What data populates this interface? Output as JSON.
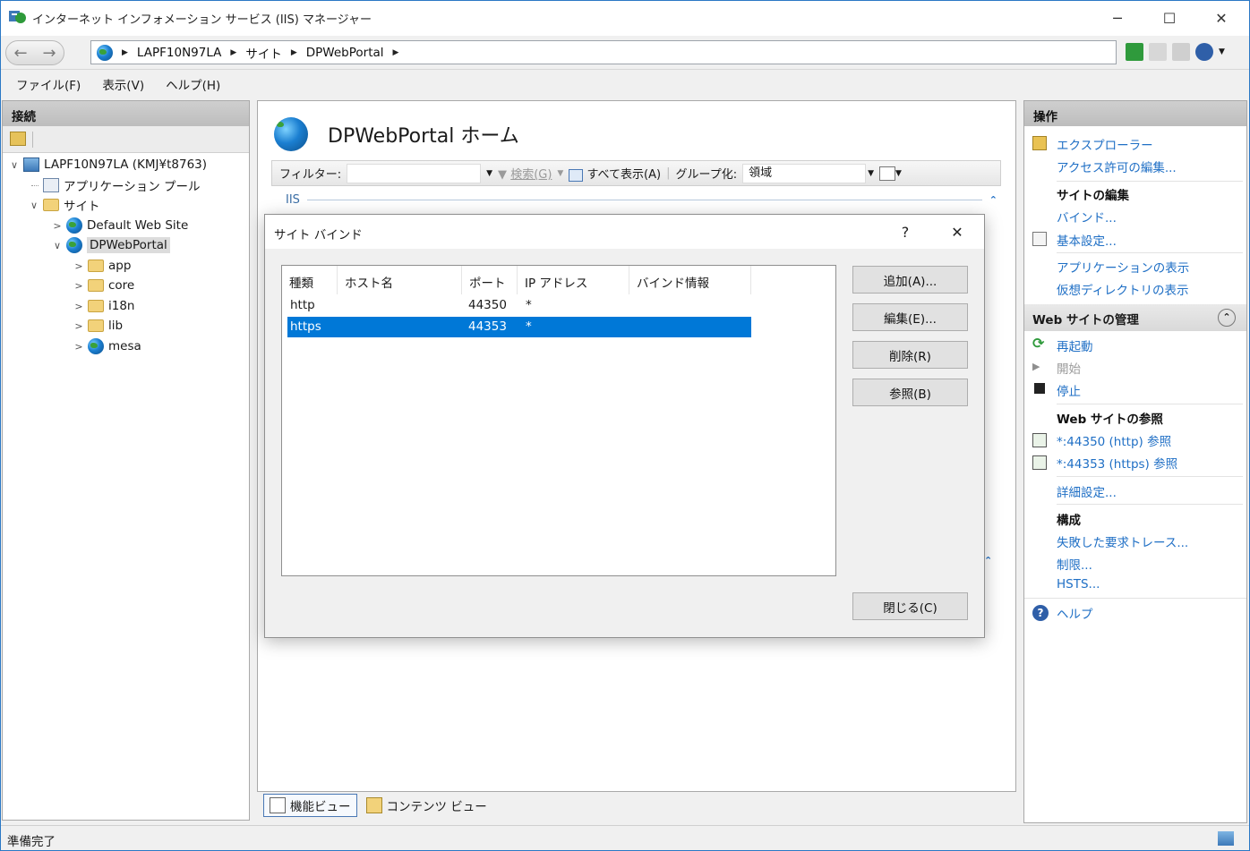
{
  "window": {
    "title": "インターネット インフォメーション サービス (IIS) マネージャー",
    "minimize": "─",
    "maximize": "☐",
    "close": "✕"
  },
  "address": {
    "crumbs": [
      "LAPF10N97LA",
      "サイト",
      "DPWebPortal"
    ],
    "separator": "▶",
    "back": "←",
    "forward": "→"
  },
  "menu": [
    "ファイル(F)",
    "表示(V)",
    "ヘルプ(H)"
  ],
  "connections": {
    "header": "接続",
    "tree": [
      {
        "label": "LAPF10N97LA (KMJ¥t8763)",
        "twisty": "∨"
      },
      {
        "label": "アプリケーション プール",
        "twisty": ""
      },
      {
        "label": "サイト",
        "twisty": "∨"
      },
      {
        "label": "Default Web Site",
        "twisty": ">"
      },
      {
        "label": "DPWebPortal",
        "twisty": "∨"
      },
      {
        "label": "app",
        "twisty": ">"
      },
      {
        "label": "core",
        "twisty": ">"
      },
      {
        "label": "i18n",
        "twisty": ">"
      },
      {
        "label": "lib",
        "twisty": ">"
      },
      {
        "label": "mesa",
        "twisty": ">"
      }
    ]
  },
  "center": {
    "title": "DPWebPortal ホーム",
    "filter_label": "フィルター:",
    "search_label": "検索(G)",
    "show_all_label": "すべて表示(A)",
    "group_label": "グループ化:",
    "group_value": "領域",
    "section_label": "IIS",
    "view_feature": "機能ビュー",
    "view_content": "コンテンツ ビュー"
  },
  "actions": {
    "header": "操作",
    "explore": "エクスプローラー",
    "edit_permissions": "アクセス許可の編集...",
    "edit_site_heading": "サイトの編集",
    "bindings": "バインド...",
    "basic_settings": "基本設定...",
    "view_applications": "アプリケーションの表示",
    "view_vdirs": "仮想ディレクトリの表示",
    "manage_heading": "Web サイトの管理",
    "restart": "再起動",
    "start": "開始",
    "stop": "停止",
    "browse_heading": "Web サイトの参照",
    "browse_http": "*:44350 (http) 参照",
    "browse_https": "*:44353 (https) 参照",
    "advanced": "詳細設定...",
    "config_heading": "構成",
    "failed_trace": "失敗した要求トレース...",
    "limits": "制限...",
    "hsts": "HSTS...",
    "help": "ヘルプ",
    "collapse": "⌃"
  },
  "status": "準備完了",
  "dialog": {
    "title": "サイト バインド",
    "help": "?",
    "close": "✕",
    "columns": [
      "種類",
      "ホスト名",
      "ポート",
      "IP アドレス",
      "バインド情報"
    ],
    "rows": [
      {
        "type": "http",
        "host": "",
        "port": "44350",
        "ip": "*",
        "info": ""
      },
      {
        "type": "https",
        "host": "",
        "port": "44353",
        "ip": "*",
        "info": ""
      }
    ],
    "selected_row": 1,
    "buttons": {
      "add": "追加(A)...",
      "edit": "編集(E)...",
      "remove": "削除(R)",
      "browse": "参照(B)",
      "close": "閉じる(C)"
    }
  },
  "colors": {
    "accent": "#0078d7",
    "link": "#1f6fc5",
    "panel_header": "#c8c8c8"
  }
}
